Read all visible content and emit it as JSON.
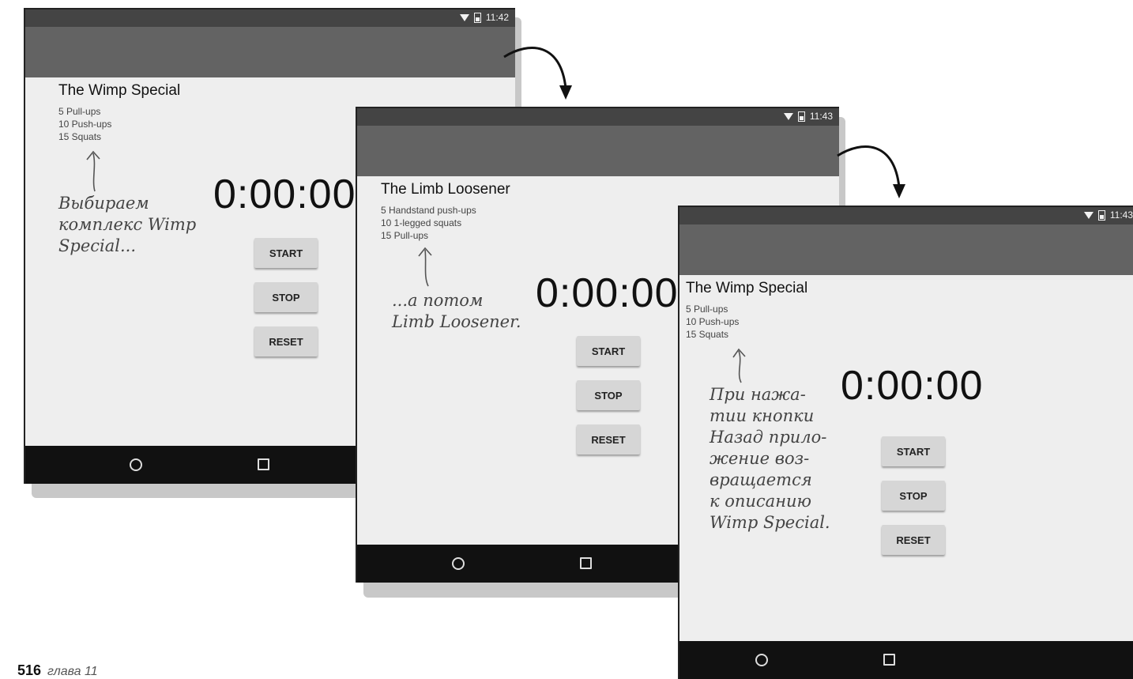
{
  "screens": [
    {
      "time": "11:42",
      "workout_title": "The Wimp Special",
      "workout_lines": [
        "5 Pull-ups",
        "10 Push-ups",
        "15 Squats"
      ],
      "timer": "0:00:00",
      "buttons": {
        "start": "START",
        "stop": "STOP",
        "reset": "RESET"
      }
    },
    {
      "time": "11:43",
      "workout_title": "The Limb Loosener",
      "workout_lines": [
        "5 Handstand push-ups",
        "10 1-legged squats",
        "15 Pull-ups"
      ],
      "timer": "0:00:00",
      "buttons": {
        "start": "START",
        "stop": "STOP",
        "reset": "RESET"
      }
    },
    {
      "time": "11:43",
      "workout_title": "The Wimp Special",
      "workout_lines": [
        "5 Pull-ups",
        "10 Push-ups",
        "15 Squats"
      ],
      "timer": "0:00:00",
      "buttons": {
        "start": "START",
        "stop": "STOP",
        "reset": "RESET"
      }
    }
  ],
  "annotations": {
    "note1": "Выбираем\nкомплекс Wimp\nSpecial...",
    "note2": "...а потом\nLimb Loosener.",
    "note3": "При нажа-\nтии кнопки\nНазад прило-\nжение воз-\nвращается\nк описанию\nWimp Special."
  },
  "footer": {
    "page_number": "516",
    "chapter": "глава 11"
  },
  "icons": [
    "wifi-icon",
    "battery-icon",
    "home-circle-icon",
    "recent-apps-square-icon",
    "curved-arrow-icon",
    "up-arrow-icon"
  ]
}
